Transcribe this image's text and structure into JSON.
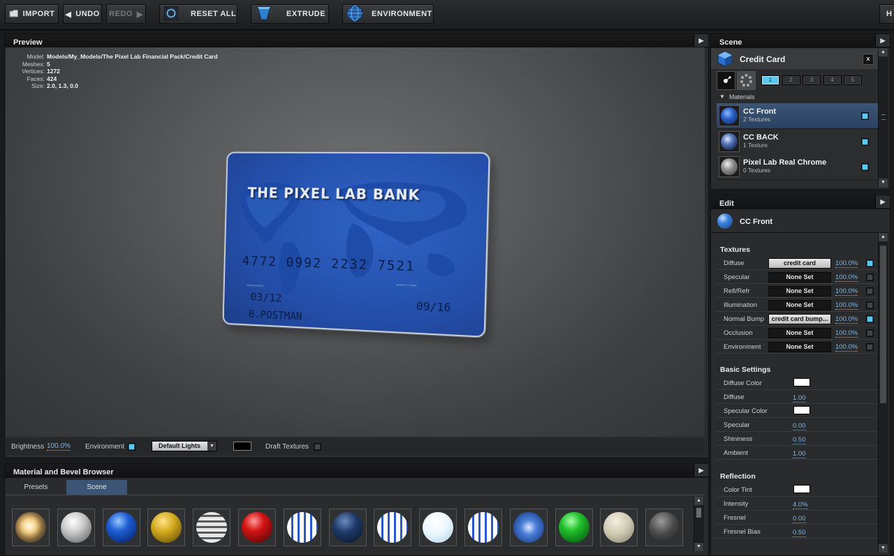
{
  "toolbar": {
    "import": "IMPORT",
    "undo": "UNDO",
    "redo": "REDO",
    "reset_all": "RESET ALL",
    "extrude": "EXTRUDE",
    "environment": "ENVIRONMENT",
    "right_cut": "H"
  },
  "preview": {
    "title": "Preview",
    "info": {
      "model_label": "Model:",
      "model": "Models/My_Models/The Pixel Lab Financial Pack/Credit Card",
      "meshes_label": "Meshes:",
      "meshes": "5",
      "vertices_label": "Vertices:",
      "vertices": "1272",
      "faces_label": "Faces:",
      "faces": "424",
      "size_label": "Size:",
      "size": "2.0, 1.3, 0.0"
    },
    "card": {
      "bank": "THE PIXEL LAB BANK",
      "number": "4772 0992 2232 7521",
      "valid_label": "VALID DATES",
      "expires_label": "MONTH / YEAR",
      "date_from": "03/12",
      "date_to": "09/16",
      "holder": "B.POSTMAN"
    },
    "footer": {
      "brightness_label": "Brightness",
      "brightness_value": "100.0%",
      "environment_label": "Environment",
      "lights_value": "Default Lights",
      "draft_label": "Draft Textures"
    }
  },
  "scene": {
    "title": "Scene",
    "object_name": "Credit Card",
    "close": "x",
    "slots": [
      "1",
      "2",
      "3",
      "4",
      "5"
    ],
    "materials_label": "Materials",
    "materials": [
      {
        "name": "CC Front",
        "sub": "2 Textures"
      },
      {
        "name": "CC BACK",
        "sub": "1 Texture"
      },
      {
        "name": "Pixel Lab Real Chrome",
        "sub": "0 Textures"
      }
    ]
  },
  "edit": {
    "title": "Edit",
    "material": "CC Front",
    "textures_label": "Textures",
    "textures": [
      {
        "label": "Diffuse",
        "value": "credit card",
        "pct": "100.0%",
        "on": true
      },
      {
        "label": "Specular",
        "value": "None Set",
        "pct": "100.0%",
        "on": false
      },
      {
        "label": "Refl/Refr",
        "value": "None Set",
        "pct": "100.0%",
        "on": false
      },
      {
        "label": "Illumination",
        "value": "None Set",
        "pct": "100.0%",
        "on": false
      },
      {
        "label": "Normal Bump",
        "value": "credit card bump...",
        "pct": "100.0%",
        "on": true
      },
      {
        "label": "Occlusion",
        "value": "None Set",
        "pct": "100.0%",
        "on": false
      },
      {
        "label": "Environment",
        "value": "None Set",
        "pct": "100.0%",
        "on": false
      }
    ],
    "basic_label": "Basic Settings",
    "basic": [
      {
        "label": "Diffuse Color",
        "type": "color"
      },
      {
        "label": "Diffuse",
        "value": "1.00"
      },
      {
        "label": "Specular Color",
        "type": "color"
      },
      {
        "label": "Specular",
        "value": "0.00"
      },
      {
        "label": "Shininess",
        "value": "0.50"
      },
      {
        "label": "Ambient",
        "value": "1.00"
      }
    ],
    "reflection_label": "Reflection",
    "reflection": [
      {
        "label": "Color Tint",
        "type": "color"
      },
      {
        "label": "Intensity",
        "value": "4.0%"
      },
      {
        "label": "Fresnel",
        "value": "0.00"
      },
      {
        "label": "Fresnel Bias",
        "value": "0.50"
      }
    ]
  },
  "browser": {
    "title": "Material and Bevel Browser",
    "tabs": [
      "Presets",
      "Scene"
    ],
    "active_tab": "Scene",
    "spheres": [
      "glow",
      "pearl",
      "blue-gloss",
      "gold",
      "striped-chrome",
      "red-gloss",
      "american-flag",
      "navy",
      "american-flag",
      "white",
      "american-flag",
      "blue-e",
      "green-gloss",
      "cream",
      "dark-gray"
    ]
  },
  "colors": {
    "accent": "#5cc8f0",
    "selection": "#3c5575",
    "link": "#7eb6e8",
    "card_blue": "#2551ad"
  }
}
